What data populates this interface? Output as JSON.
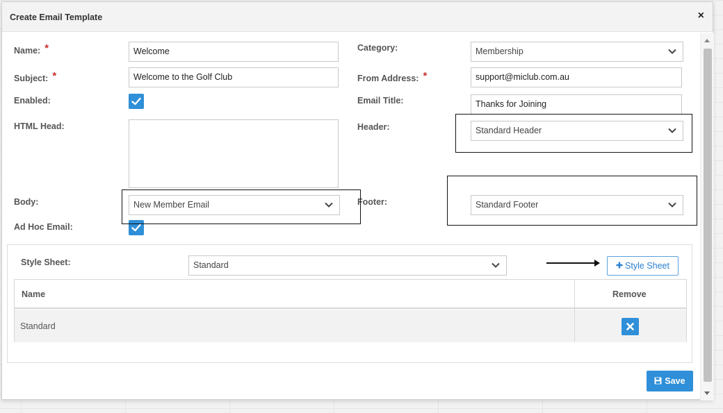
{
  "dialog": {
    "title": "Create Email Template",
    "close_glyph": "×"
  },
  "form": {
    "name": {
      "label": "Name:",
      "value": "Welcome",
      "required_mark": "*"
    },
    "subject": {
      "label": "Subject:",
      "value": "Welcome to the Golf Club",
      "required_mark": "*"
    },
    "enabled": {
      "label": "Enabled:",
      "checked": true
    },
    "html_head": {
      "label": "HTML Head:",
      "value": ""
    },
    "body": {
      "label": "Body:",
      "selected": "New Member Email"
    },
    "ad_hoc": {
      "label": "Ad Hoc Email:",
      "checked": true
    },
    "category": {
      "label": "Category:",
      "selected": "Membership"
    },
    "from_address": {
      "label": "From Address:",
      "value": "support@miclub.com.au",
      "required_mark": "*"
    },
    "email_title": {
      "label": "Email Title:",
      "value": "Thanks for Joining"
    },
    "header": {
      "label": "Header:",
      "selected": "Standard Header"
    },
    "footer": {
      "label": "Footer:",
      "selected": "Standard Footer"
    }
  },
  "stylesheet_panel": {
    "label": "Style Sheet:",
    "selected": "Standard",
    "add_button_label": "Style Sheet",
    "add_button_icon": "plus-icon",
    "table": {
      "columns": [
        "Name",
        "Remove"
      ],
      "rows": [
        {
          "name": "Standard",
          "remove_icon": "close-icon"
        }
      ]
    }
  },
  "actions": {
    "save_label": "Save",
    "save_icon": "floppy-disk-icon"
  },
  "colors": {
    "primary": "#2f8fd8",
    "required": "#c9302c"
  }
}
